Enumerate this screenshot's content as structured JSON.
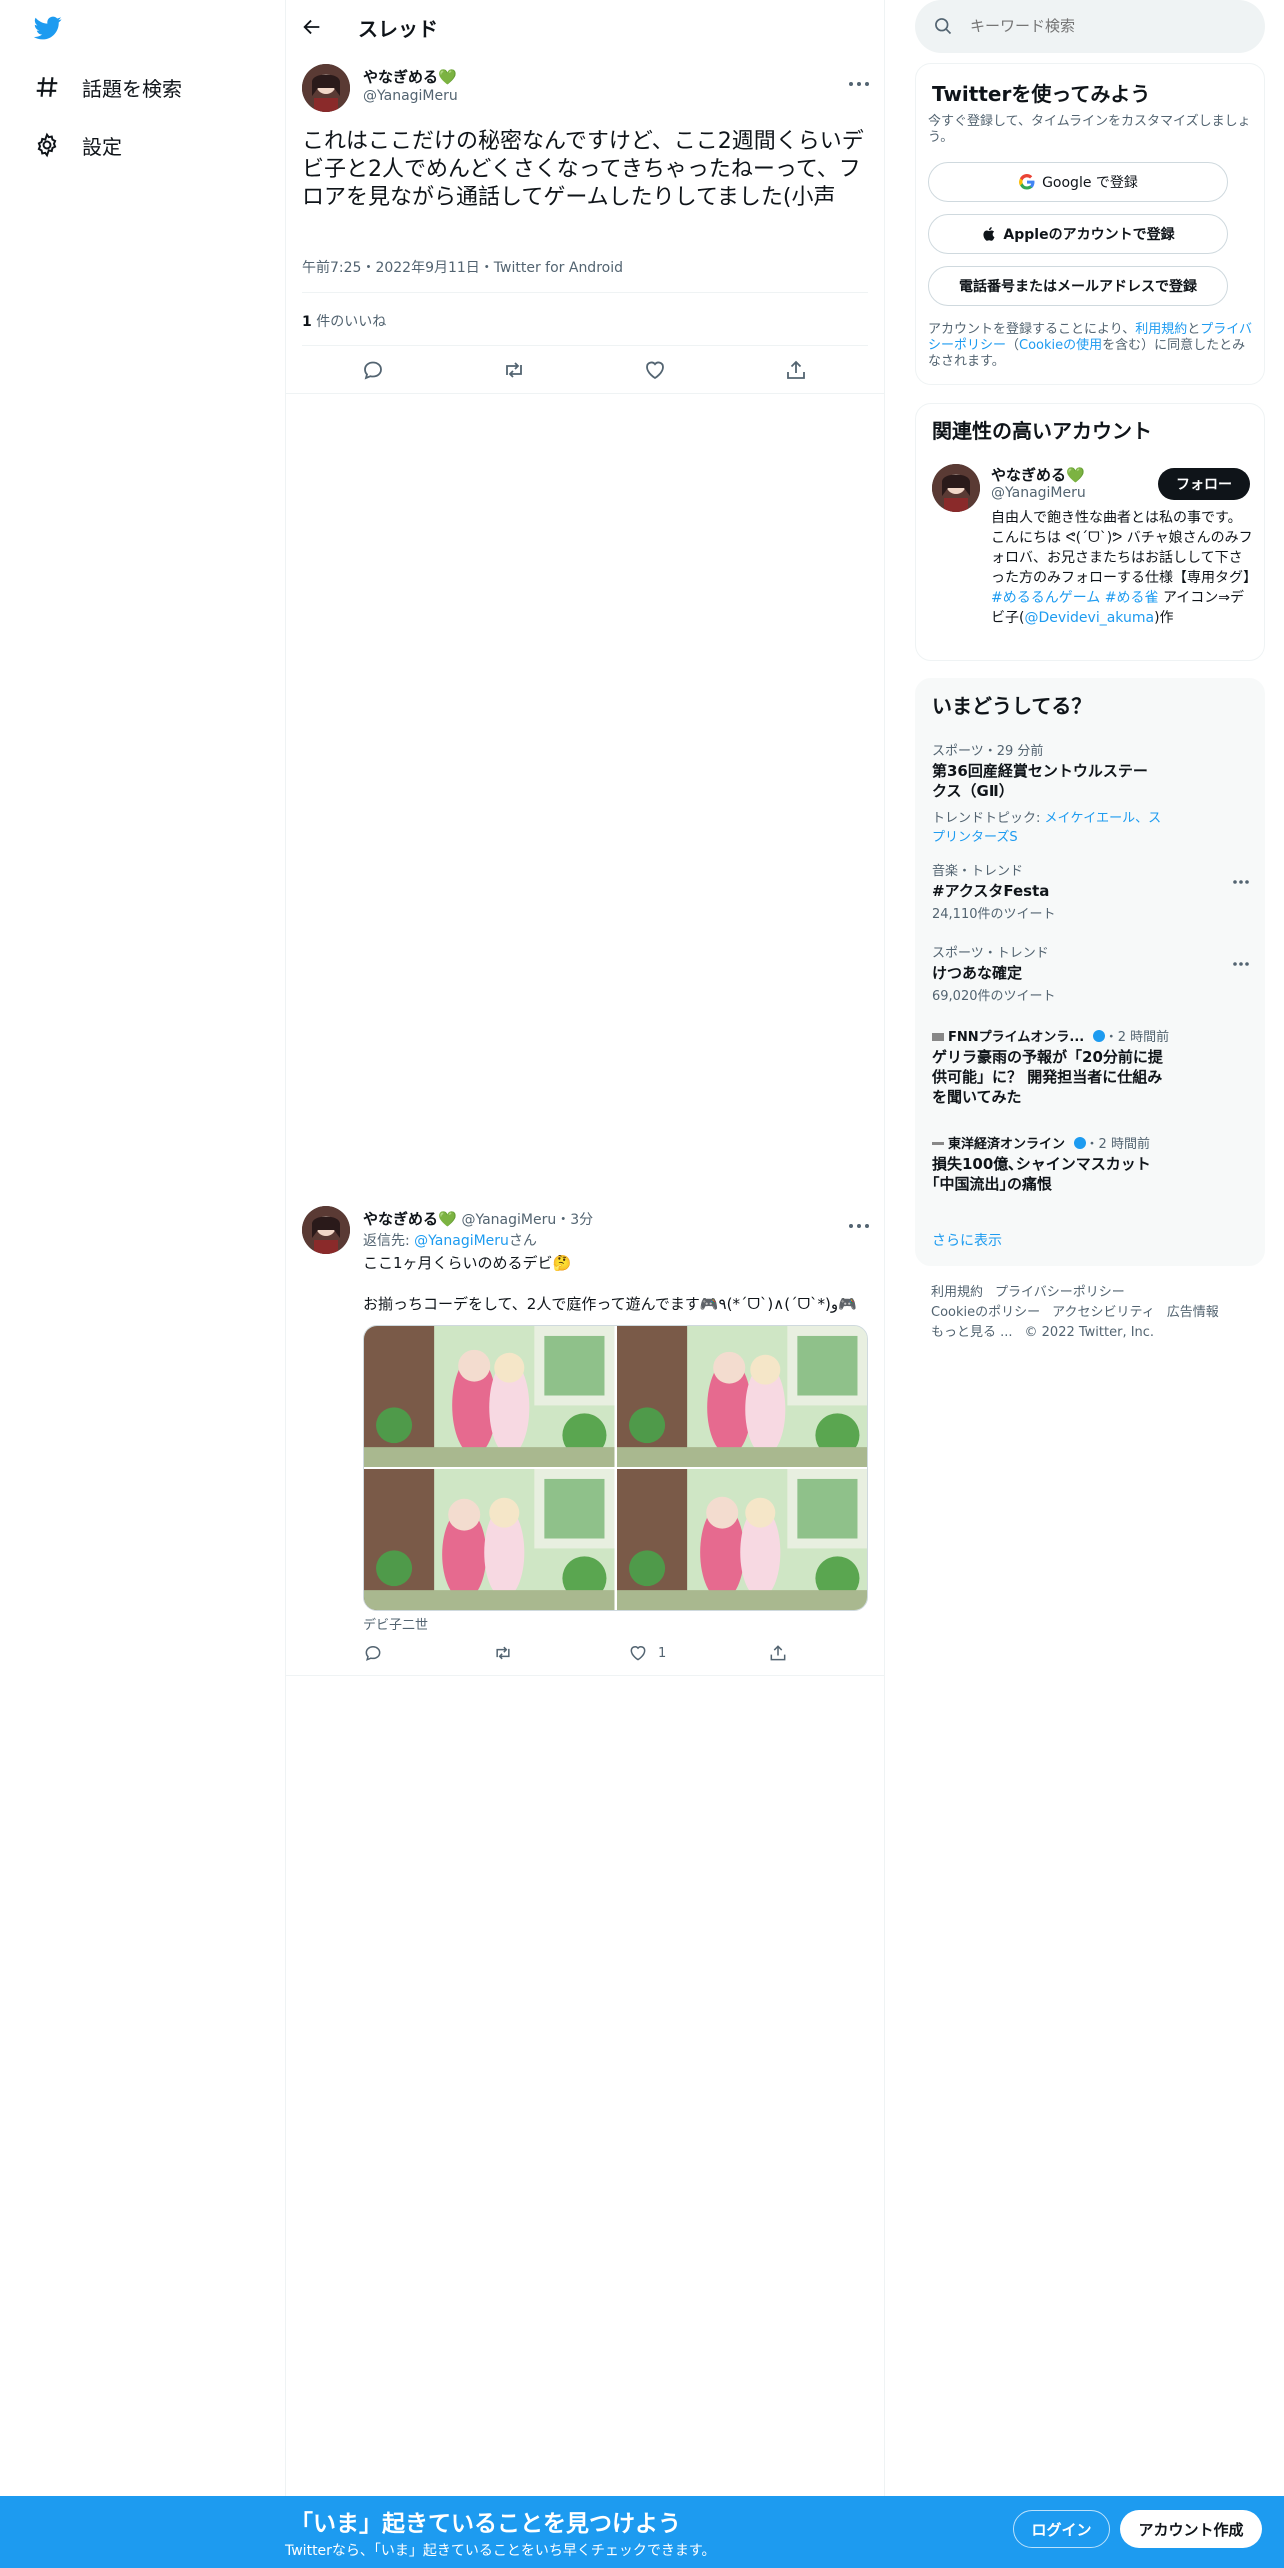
{
  "nav": {
    "explore_label": "話題を検索",
    "settings_label": "設定"
  },
  "header": {
    "title": "スレッド"
  },
  "main_tweet": {
    "display_name": "やなぎめる💚",
    "handle": "@YanagiMeru",
    "text": "これはここだけの秘密なんですけど、ここ2週間くらいデビ子と2人でめんどくさくなってきちゃったねーって、フロアを見ながら通話してゲームしたりしてました(小声",
    "meta": "午前7:25・2022年9月11日・Twitter for Android",
    "likes_count": "1",
    "likes_label": " 件のいいね"
  },
  "reply_tweet": {
    "display_name": "やなぎめる💚",
    "handle": "@YanagiMeru",
    "time": "・3分",
    "reply_prefix": "返信先: ",
    "reply_handle": "@YanagiMeru",
    "reply_suffix": "さん",
    "line1": "ここ1ヶ月くらいのめるデビ🤔",
    "line2": "お揃っちコーデをして、2人で庭作って遊んでます🎮٩(*ˊᗜˋ)∧(ˊᗜˋ*)و🎮",
    "caption": "デビ子二世",
    "like_count": "1"
  },
  "search": {
    "placeholder": "キーワード検索"
  },
  "signup_card": {
    "title": "Twitterを使ってみよう",
    "subtitle": "今すぐ登録して、タイムラインをカスタマイズしましょう。",
    "google_label": "Google で登録",
    "apple_label": "Appleのアカウントで登録",
    "phone_label": "電話番号またはメールアドレスで登録",
    "terms_prefix": "アカウントを登録することにより、",
    "terms_link": "利用規約",
    "terms_and": "と",
    "privacy_link": "プライバシーポリシー",
    "terms_paren_open": "（",
    "cookie_link": "Cookieの使用",
    "terms_suffix": "を含む）に同意したとみなされます。"
  },
  "related_card": {
    "title": "関連性の高いアカウント",
    "display_name": "やなぎめる💚",
    "handle": "@YanagiMeru",
    "follow_label": "フォロー",
    "bio_1": "自由人で飽き性な曲者とは私の事です。こんにちは ᕙ(ˊᗜˋ)ᕗ バチャ娘さんのみフォロバ、お兄さまたちはお話しして下さった方のみフォローする仕様【専用タグ】",
    "bio_tag1": "#めるるんゲーム",
    "bio_tag2": "#める雀",
    "bio_2": " アイコン⇒デビ子(",
    "bio_mention": "@Devidevi_akuma",
    "bio_3": ")作"
  },
  "trends": {
    "title": "いまどうしてる？",
    "items": [
      {
        "category": "スポーツ・29 分前",
        "title": "第36回産経賞セントウルステークス（GⅡ）",
        "topics_label": "トレンドトピック: ",
        "topics": "メイケイエール、スプリンターズS"
      },
      {
        "category": "音楽・トレンド",
        "title": "#アクスタFesta",
        "count": "24,110件のツイート"
      },
      {
        "category": "スポーツ・トレンド",
        "title": "けつあな確定",
        "count": "69,020件のツイート"
      },
      {
        "source": "FNNプライムオンラ...",
        "time": "・2 時間前",
        "title": "ゲリラ豪雨の予報が「20分前に提供可能」に？ 開発担当者に仕組みを聞いてみた"
      },
      {
        "source": "東洋経済オンライン",
        "time": "・2 時間前",
        "title": "損失100億､シャインマスカット｢中国流出｣の痛恨"
      }
    ],
    "show_more": "さらに表示"
  },
  "footer": {
    "links": [
      "利用規約",
      "プライバシーポリシー",
      "Cookieのポリシー",
      "アクセシビリティ",
      "広告情報",
      "もっと見る ...",
      "© 2022 Twitter, Inc."
    ]
  },
  "banner": {
    "title": "「いま」起きていることを見つけよう",
    "subtitle": "Twitterなら、「いま」起きていることをいち早くチェックできます。",
    "login_label": "ログイン",
    "signup_label": "アカウント作成"
  },
  "colors": {
    "brand": "#1d9bf0",
    "text": "#0f1419",
    "muted": "#536471",
    "border": "#eff3f4",
    "panel": "#f7f9f9"
  },
  "icons": [
    "twitter-logo-icon",
    "hashtag-icon",
    "gear-icon",
    "back-arrow-icon",
    "more-icon",
    "reply-icon",
    "retweet-icon",
    "like-icon",
    "share-icon",
    "search-icon",
    "google-icon",
    "apple-icon",
    "verified-icon"
  ]
}
